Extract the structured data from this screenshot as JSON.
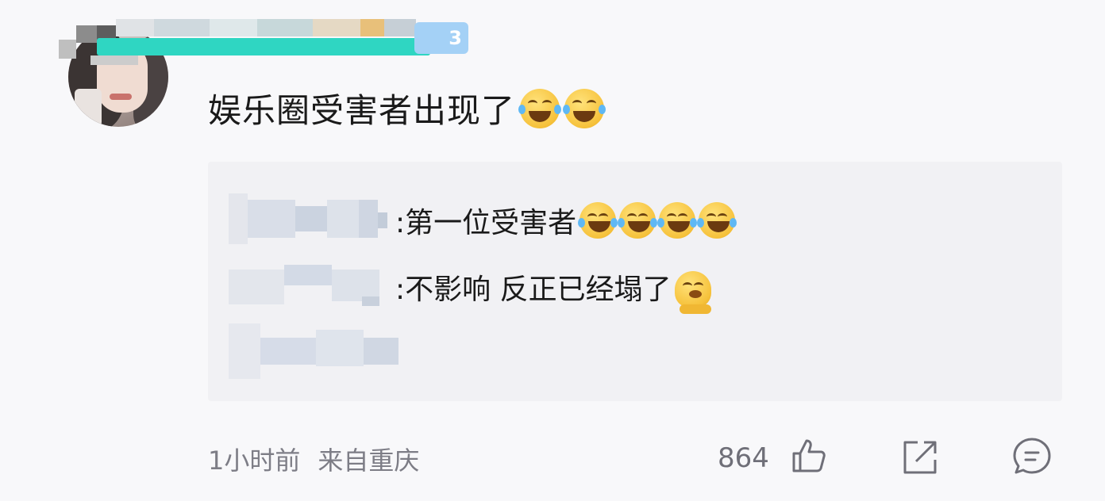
{
  "comment": {
    "level_badge": "3",
    "text": "娱乐圈受害者出现了",
    "emojis": [
      "laugh-cry-emoji",
      "laugh-cry-emoji"
    ]
  },
  "replies": [
    {
      "text": ":第一位受害者",
      "emojis": [
        "laugh-cry-emoji",
        "laugh-cry-emoji",
        "laugh-cry-emoji",
        "laugh-cry-emoji"
      ]
    },
    {
      "text": ":不影响 反正已经塌了",
      "emojis": [
        "melting-face-emoji"
      ]
    },
    {
      "text": "",
      "emojis": []
    }
  ],
  "footer": {
    "time": "1小时前",
    "location": "来自重庆",
    "like_count": "864",
    "icons": [
      "thumbs-up-icon",
      "share-icon",
      "comment-icon"
    ]
  },
  "colors": {
    "name_highlight": "#2fd6c2",
    "level_badge": "#a4d1f6",
    "reply_bg": "#f1f1f4",
    "meta_text": "#7d7d86"
  }
}
